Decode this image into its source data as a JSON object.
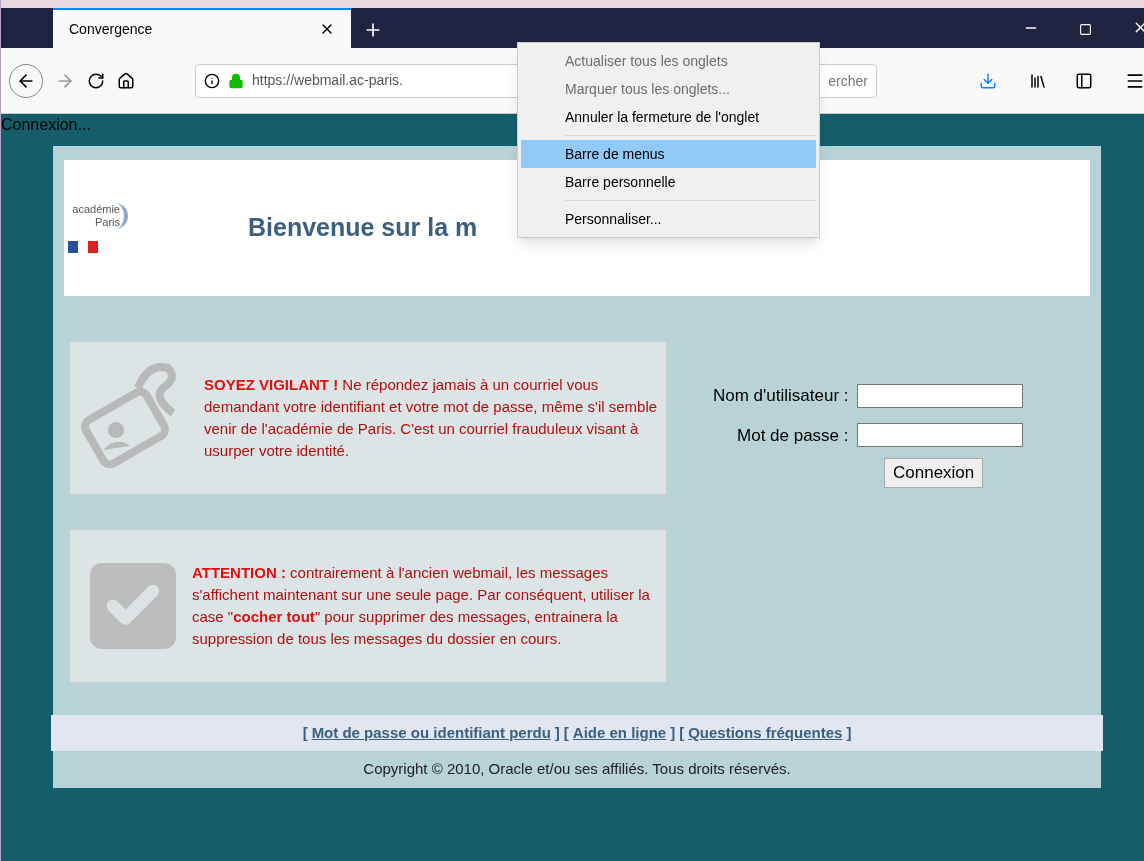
{
  "browser": {
    "tabs": [
      {
        "title": "Convergence",
        "selected": true
      }
    ],
    "url": "https://webmail.ac-paris.",
    "search": {
      "placeholder": "ercher"
    }
  },
  "status_text": "Connexion...",
  "context_menu": [
    {
      "kind": "item",
      "label": "Actualiser tous les onglets",
      "disabled": true,
      "selected": false
    },
    {
      "kind": "item",
      "label": "Marquer tous les onglets...",
      "disabled": true,
      "selected": false
    },
    {
      "kind": "item",
      "label": "Annuler la fermeture de l'onglet",
      "disabled": false,
      "selected": false
    },
    {
      "kind": "separator"
    },
    {
      "kind": "item",
      "label": "Barre de menus",
      "disabled": false,
      "selected": true
    },
    {
      "kind": "item",
      "label": "Barre personnelle",
      "disabled": false,
      "selected": false
    },
    {
      "kind": "separator"
    },
    {
      "kind": "item",
      "label": "Personnaliser...",
      "disabled": false,
      "selected": false
    }
  ],
  "header": {
    "logo_lines": [
      "académie",
      "Paris"
    ],
    "title": "Bienvenue sur la m"
  },
  "notices": [
    {
      "kind": "phishing",
      "text": "**SOYEZ VIGILANT !** Ne répondez jamais à un courriel vous demandant votre identifiant et votre mot de passe, même s'il semble venir de l'académie de Paris. C'est un courriel frauduleux visant à usurper votre identité."
    },
    {
      "kind": "check",
      "text": "**ATTENTION :** contrairement à l'ancien webmail, les messages s'affichent maintenant sur une seule page. Par conséquent, utiliser la case \"**cocher tout**\" pour supprimer des messages, entrainera la suppression de tous les messages du dossier en cours."
    }
  ],
  "login": {
    "fields": [
      {
        "label": "Nom d'utilisateur :"
      },
      {
        "label": "Mot de passe :"
      }
    ],
    "button": "Connexion"
  },
  "footer": {
    "links": [
      "Mot de passe ou identifiant perdu",
      "Aide en ligne",
      "Questions fréquentes"
    ],
    "brackets": {
      "open": "[",
      "close": "]"
    },
    "copyright": "Copyright © 2010, Oracle et/ou ses affiliés. Tous droits réservés."
  }
}
